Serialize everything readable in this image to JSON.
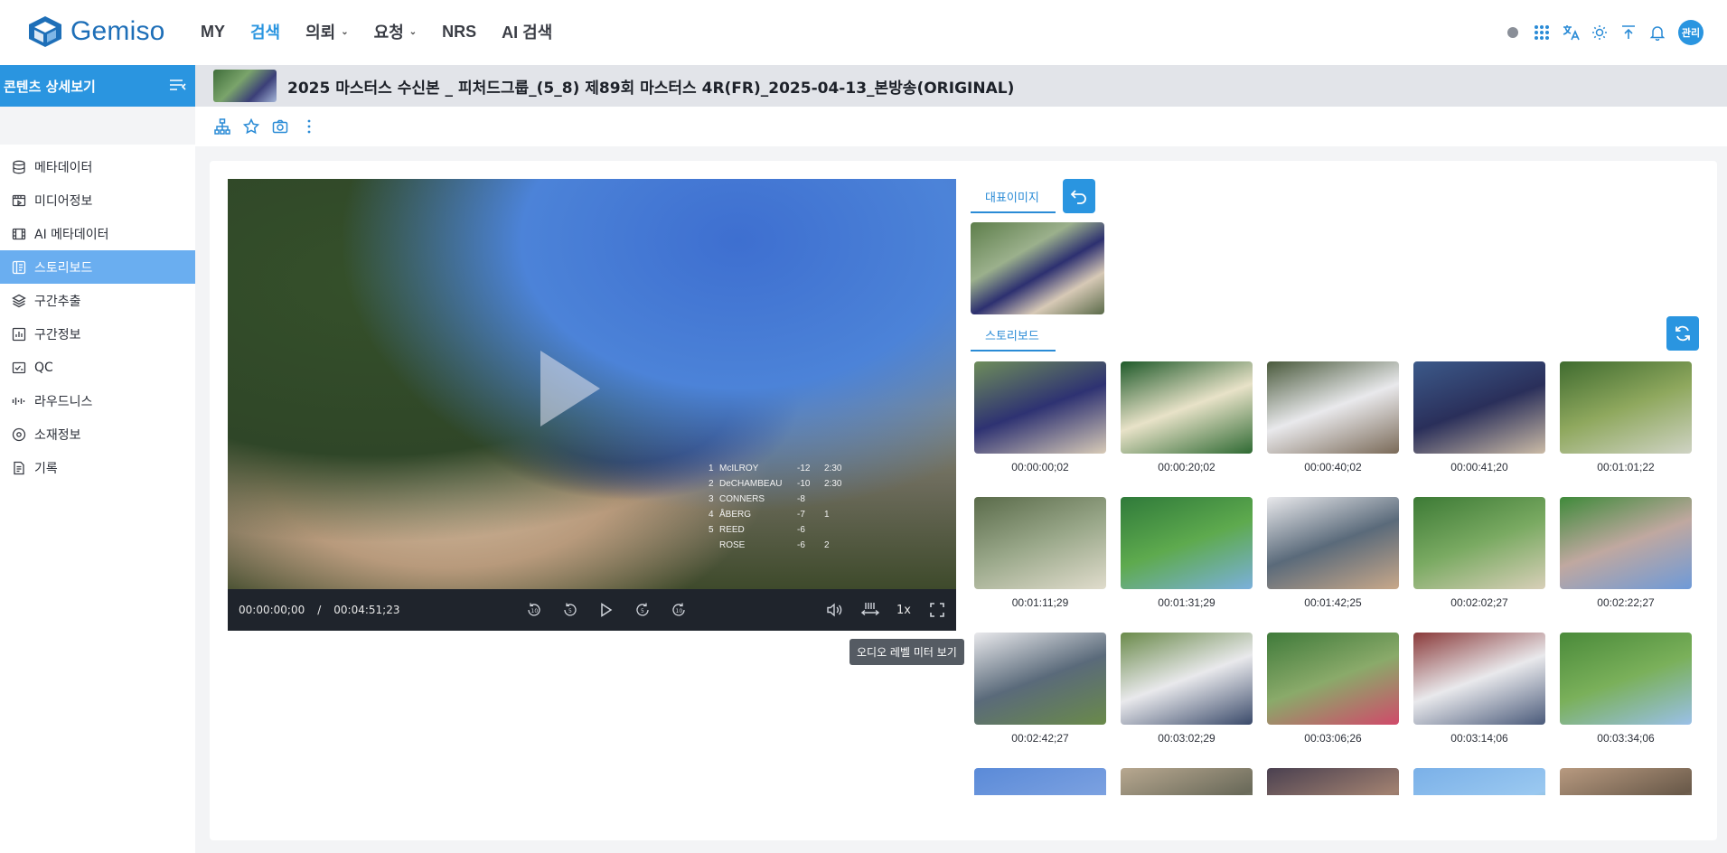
{
  "brand": {
    "name": "Gemiso"
  },
  "nav": {
    "items": [
      {
        "label": "MY",
        "active": false,
        "dropdown": false
      },
      {
        "label": "검색",
        "active": true,
        "dropdown": false
      },
      {
        "label": "의뢰",
        "active": false,
        "dropdown": true
      },
      {
        "label": "요청",
        "active": false,
        "dropdown": true
      },
      {
        "label": "NRS",
        "active": false,
        "dropdown": false
      },
      {
        "label": "AI 검색",
        "active": false,
        "dropdown": false
      }
    ],
    "tools": [
      "status-dot-icon",
      "apps-grid-icon",
      "translate-icon",
      "sun-icon",
      "upload-icon",
      "bell-icon"
    ],
    "user_badge": "관리"
  },
  "sidebar": {
    "title": "콘텐츠 상세보기",
    "items": [
      {
        "label": "메타데이터",
        "icon": "database-icon",
        "active": false
      },
      {
        "label": "미디어정보",
        "icon": "media-icon",
        "active": false
      },
      {
        "label": "AI 메타데이터",
        "icon": "film-icon",
        "active": false
      },
      {
        "label": "스토리보드",
        "icon": "storyboard-icon",
        "active": true
      },
      {
        "label": "구간추출",
        "icon": "layers-icon",
        "active": false
      },
      {
        "label": "구간정보",
        "icon": "bar-chart-icon",
        "active": false
      },
      {
        "label": "QC",
        "icon": "qc-icon",
        "active": false
      },
      {
        "label": "라우드니스",
        "icon": "waveform-icon",
        "active": false
      },
      {
        "label": "소재정보",
        "icon": "disc-icon",
        "active": false
      },
      {
        "label": "기록",
        "icon": "log-icon",
        "active": false
      }
    ]
  },
  "content": {
    "title": "2025 마스터스 수신본 _ 피처드그룹_(5_8) 제89회 마스터스 4R(FR)_2025-04-13_본방송(ORIGINAL)"
  },
  "player": {
    "current_time": "00:00:00;00",
    "separator": "/",
    "duration": "00:04:51;23",
    "speed": "1x",
    "tooltip": "오디오 레벨 미터 보기",
    "scoreboard": [
      {
        "pos": "1",
        "name": "McILROY",
        "score": "-12",
        "thru": "2:30"
      },
      {
        "pos": "2",
        "name": "DeCHAMBEAU",
        "score": "-10",
        "thru": "2:30"
      },
      {
        "pos": "3",
        "name": "CONNERS",
        "score": "-8",
        "thru": ""
      },
      {
        "pos": "4",
        "name": "ÅBERG",
        "score": "-7",
        "thru": "1"
      },
      {
        "pos": "5",
        "name": "REED",
        "score": "-6",
        "thru": ""
      },
      {
        "pos": "",
        "name": "ROSE",
        "score": "-6",
        "thru": "2"
      }
    ]
  },
  "tabs": {
    "representative": "대표이미지",
    "storyboard": "스토리보드"
  },
  "storyboard": {
    "frames": [
      {
        "timecode": "00:00:00;02",
        "color": [
          "#6e8d5a",
          "#2e3272",
          "#d8cbb7"
        ]
      },
      {
        "timecode": "00:00:20;02",
        "color": [
          "#1f5a2a",
          "#e8e2c8",
          "#2f6a33"
        ]
      },
      {
        "timecode": "00:00:40;02",
        "color": [
          "#4a5a3c",
          "#e9e9ec",
          "#7a6a58"
        ]
      },
      {
        "timecode": "00:00:41;20",
        "color": [
          "#3c5a8a",
          "#2a2f5a",
          "#cbbba6"
        ]
      },
      {
        "timecode": "00:01:01;22",
        "color": [
          "#3f6b2f",
          "#8fa85e",
          "#cfd3c4"
        ]
      },
      {
        "timecode": "00:01:11;29",
        "color": [
          "#5a6b4a",
          "#9aa88a",
          "#e0dccc"
        ]
      },
      {
        "timecode": "00:01:31;29",
        "color": [
          "#2f7a3a",
          "#5eaa4e",
          "#7bb0dc"
        ]
      },
      {
        "timecode": "00:01:42;25",
        "color": [
          "#e9e9ec",
          "#5a6a7a",
          "#c8a88a"
        ]
      },
      {
        "timecode": "00:02:02;27",
        "color": [
          "#3c7a35",
          "#7aaa62",
          "#d8cfb8"
        ]
      },
      {
        "timecode": "00:02:22;27",
        "color": [
          "#3f8a3a",
          "#c0a8a0",
          "#6e9ad8"
        ]
      },
      {
        "timecode": "00:02:42;27",
        "color": [
          "#e9e9ec",
          "#5a6a7a",
          "#6a8a4a"
        ]
      },
      {
        "timecode": "00:03:02;29",
        "color": [
          "#6a8a4a",
          "#e9e9ec",
          "#3a4a6a"
        ]
      },
      {
        "timecode": "00:03:06;26",
        "color": [
          "#3f7a3a",
          "#8aaa6a",
          "#d04a6a"
        ]
      },
      {
        "timecode": "00:03:14;06",
        "color": [
          "#8a3a3a",
          "#e9e9ec",
          "#4a5a7a"
        ]
      },
      {
        "timecode": "00:03:34;06",
        "color": [
          "#4a8a3a",
          "#7ab05a",
          "#9ac0e8"
        ]
      },
      {
        "timecode": "",
        "color": [
          "#5a8ad8",
          "#7aa0e0",
          "#9ab8e8"
        ]
      },
      {
        "timecode": "",
        "color": [
          "#b8a890",
          "#6a6a5a",
          "#e0d8c8"
        ]
      },
      {
        "timecode": "",
        "color": [
          "#4a4050",
          "#a08070",
          "#3a3a4a"
        ]
      },
      {
        "timecode": "",
        "color": [
          "#7ab0e8",
          "#9ac8f0",
          "#4a8a3a"
        ]
      },
      {
        "timecode": "",
        "color": [
          "#b89a80",
          "#6a5a4a",
          "#d8c8b0"
        ]
      }
    ]
  }
}
